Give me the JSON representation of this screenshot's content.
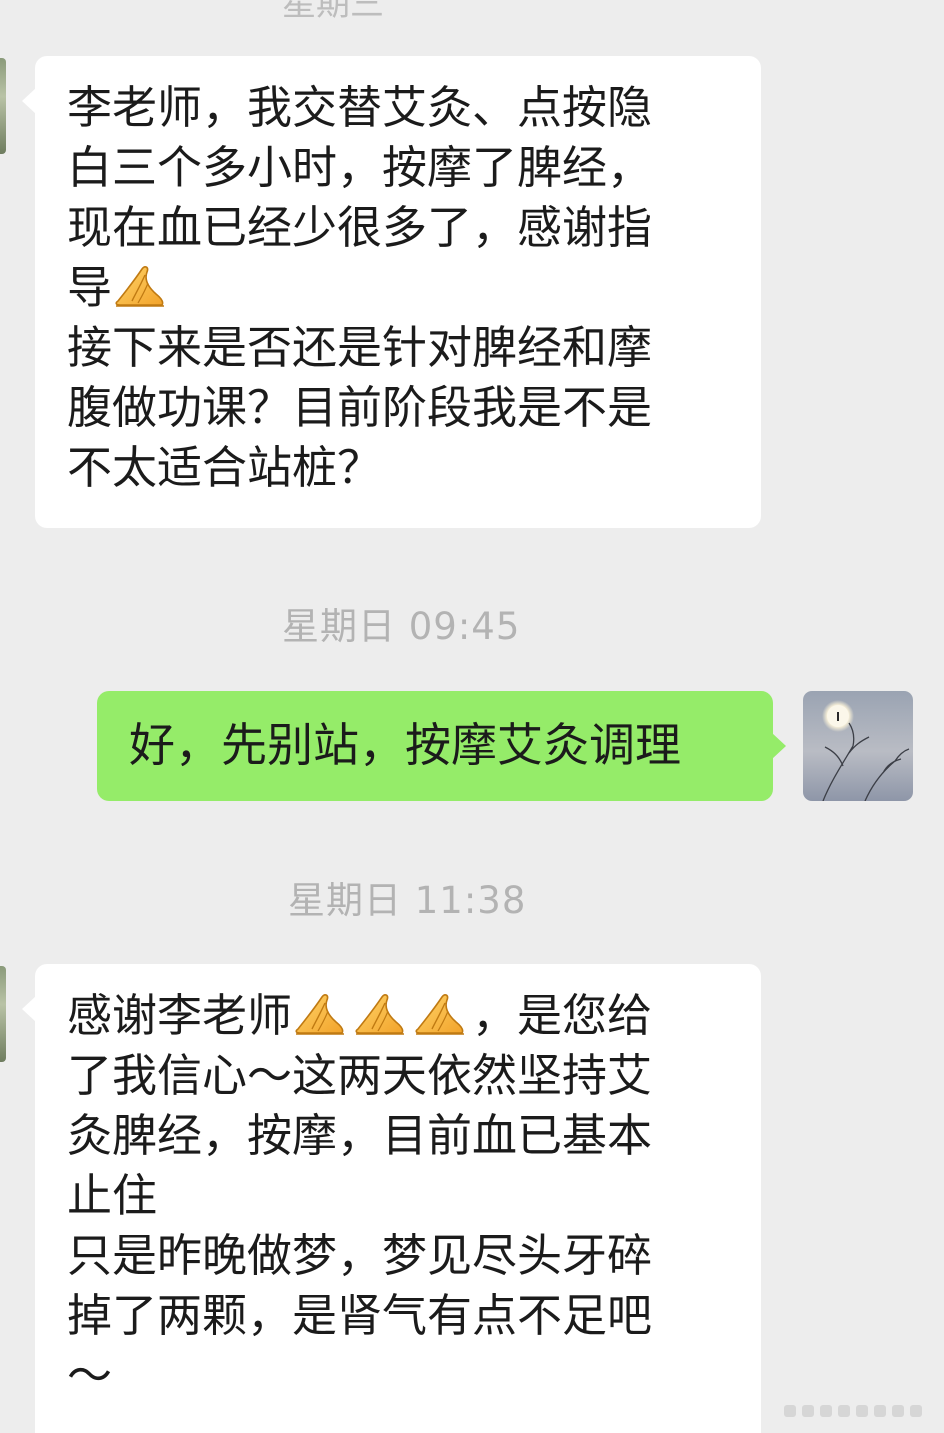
{
  "top_cut_timestamp": "星期三",
  "messages": [
    {
      "sender": "contact",
      "lines": [
        "李老师，我交替艾灸、点按隐",
        "白三个多小时，按摩了脾经，",
        "现在血已经少很多了，感谢指",
        "导",
        "接下来是否还是针对脾经和摩",
        "腹做功课？目前阶段我是不是",
        "不太适合站桩？"
      ]
    },
    {
      "timestamp": "星期日 09:45"
    },
    {
      "sender": "me",
      "text": "好，先别站，按摩艾灸调理"
    },
    {
      "timestamp": "星期日 11:38"
    },
    {
      "sender": "contact",
      "line1_prefix": "感谢李老师",
      "line1_suffix": "，是您给",
      "lines": [
        "了我信心～这两天依然坚持艾",
        "灸脾经，按摩，目前血已基本",
        "止住",
        "只是昨晚做梦，梦见尽头牙碎",
        "掉了两颗，是肾气有点不足吧",
        "～"
      ]
    }
  ],
  "icons": {
    "emoji": "folded-hands-icon",
    "my_avatar": "moon-bird-avatar"
  },
  "colors": {
    "background": "#ededed",
    "incoming_bubble": "#ffffff",
    "outgoing_bubble": "#95ec69",
    "timestamp_text": "#b3b3b3",
    "message_text": "#1b1b1b"
  }
}
